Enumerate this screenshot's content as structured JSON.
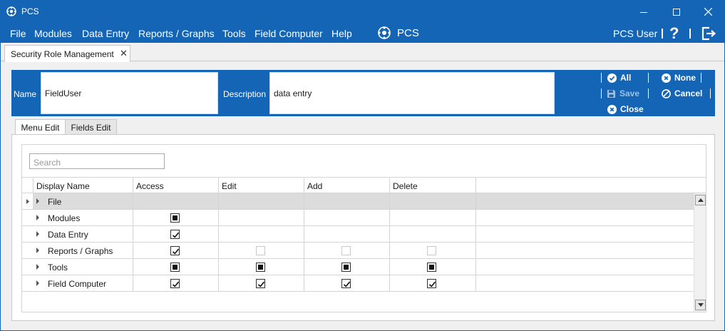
{
  "window": {
    "title": "PCS",
    "minimize_icon": "minimize-icon",
    "maximize_icon": "maximize-icon",
    "close_icon": "close-icon"
  },
  "menu": {
    "items": [
      "File",
      "Modules",
      "Data Entry",
      "Reports / Graphs",
      "Tools",
      "Field Computer",
      "Help"
    ],
    "center_brand": "PCS",
    "user": "PCS User",
    "help_glyph": "?"
  },
  "doc_tab": {
    "label": "Security Role Management",
    "close_glyph": "✕"
  },
  "header": {
    "name_label": "Name",
    "name_value": "FieldUser",
    "description_label": "Description",
    "description_value": "data entry",
    "all_label": "All",
    "none_label": "None",
    "save_label": "Save",
    "cancel_label": "Cancel",
    "close_label": "Close",
    "save_enabled": false
  },
  "tabs": {
    "menu_edit": "Menu Edit",
    "fields_edit": "Fields Edit",
    "active": "Menu Edit"
  },
  "search": {
    "placeholder": "Search",
    "value": ""
  },
  "table": {
    "columns": [
      "Display Name",
      "Access",
      "Edit",
      "Add",
      "Delete"
    ],
    "rows": [
      {
        "name": "File",
        "access": "none",
        "edit": "none",
        "add": "none",
        "delete": "none",
        "selected": true
      },
      {
        "name": "Modules",
        "access": "indeterminate",
        "edit": "none",
        "add": "none",
        "delete": "none"
      },
      {
        "name": "Data Entry",
        "access": "checked",
        "edit": "none",
        "add": "none",
        "delete": "none"
      },
      {
        "name": "Reports / Graphs",
        "access": "checked",
        "edit": "disabled",
        "add": "disabled",
        "delete": "disabled"
      },
      {
        "name": "Tools",
        "access": "indeterminate",
        "edit": "indeterminate",
        "add": "indeterminate",
        "delete": "indeterminate"
      },
      {
        "name": "Field Computer",
        "access": "checked",
        "edit": "checked",
        "add": "checked",
        "delete": "checked"
      }
    ]
  },
  "colors": {
    "brand_blue": "#1565b6",
    "selected_row": "#dcdcdc"
  }
}
